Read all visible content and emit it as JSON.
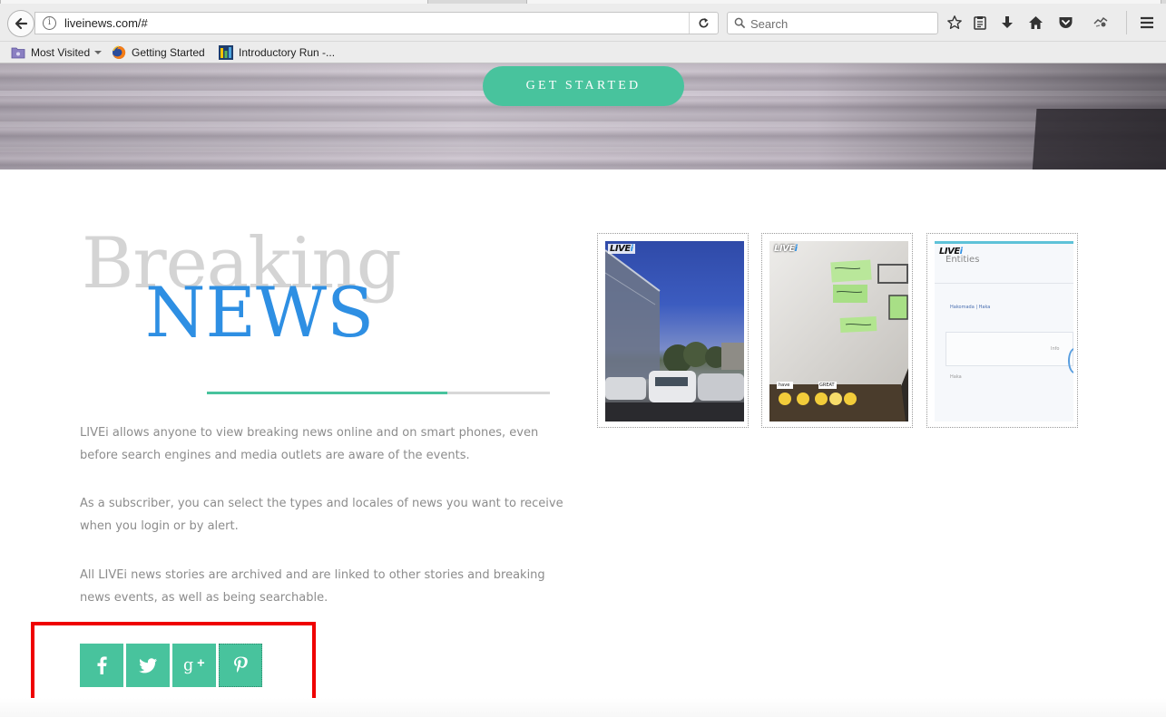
{
  "browser": {
    "url": "liveinews.com/#",
    "search_placeholder": "Search",
    "bookmarks": [
      {
        "label": "Most Visited",
        "icon": "folder-icon"
      },
      {
        "label": "Getting Started",
        "icon": "firefox-icon"
      },
      {
        "label": "Introductory Run -...",
        "icon": "bars-icon"
      }
    ]
  },
  "hero": {
    "cta_label": "GET STARTED"
  },
  "section": {
    "title_top": "Breaking",
    "title_main": "NEWS",
    "divider_progress": 0.7,
    "paragraphs": [
      "LIVEi allows anyone to view breaking news online and on smart phones, even before search engines and media outlets are aware of the events.",
      "As a subscriber, you can select the types and locales of news you want to receive when you login or by alert.",
      "All LIVEi news stories are archived and are linked to other stories and breaking news events, as well as being searchable."
    ],
    "social": [
      {
        "icon": "facebook-icon"
      },
      {
        "icon": "twitter-icon"
      },
      {
        "icon": "google-plus-icon"
      },
      {
        "icon": "pinterest-icon"
      }
    ],
    "thumbnails": [
      {
        "badge_text": "LIVE",
        "badge_accent": "i"
      },
      {
        "badge_text": "LIVE",
        "badge_accent": "i"
      },
      {
        "badge_text": "LIVE",
        "badge_accent": "i",
        "screen_title": "Entities",
        "screen_link": "Hakomada | Haka",
        "screen_field1": "Info",
        "screen_field2": "Haka"
      }
    ],
    "thumb2_notes": [
      "have",
      "GREAT"
    ]
  },
  "colors": {
    "accent_green": "#48c39d",
    "news_blue": "#2e8fe3",
    "highlight_red": "#ef0000"
  }
}
